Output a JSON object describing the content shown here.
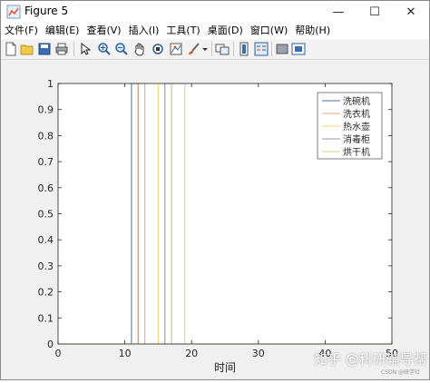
{
  "window": {
    "title": "Figure 5",
    "minimize_glyph": "—",
    "maximize_glyph": "☐",
    "close_glyph": "✕"
  },
  "menu": {
    "items": [
      "文件(F)",
      "编辑(E)",
      "查看(V)",
      "插入(I)",
      "工具(T)",
      "桌面(D)",
      "窗口(W)",
      "帮助(H)"
    ]
  },
  "toolbar": {
    "icons": [
      "new-figure-icon",
      "open-file-icon",
      "save-icon",
      "print-icon",
      "edit-plot-arrow-icon",
      "zoom-in-icon",
      "zoom-out-icon",
      "pan-hand-icon",
      "rotate-3d-icon",
      "data-cursor-icon",
      "brush-icon",
      "brush-dropdown-icon",
      "link-plot-icon",
      "insert-colorbar-icon",
      "insert-legend-icon",
      "hide-plot-tools-icon",
      "show-plot-tools-icon"
    ]
  },
  "chart_data": {
    "type": "line",
    "title": "",
    "xlabel": "时间",
    "ylabel": "",
    "xlim": [
      0,
      50
    ],
    "ylim": [
      0,
      1
    ],
    "xticks": [
      0,
      10,
      20,
      30,
      40,
      50
    ],
    "yticks": [
      0,
      0.1,
      0.2,
      0.3,
      0.4,
      0.5,
      0.6,
      0.7,
      0.8,
      0.9,
      1
    ],
    "grid": false,
    "legend_position": "top-right",
    "series": [
      {
        "name": "洗碗机",
        "color": "#4a6f9c",
        "x": [
          0,
          11,
          11,
          12,
          12,
          50
        ],
        "y": [
          0,
          0,
          1,
          1,
          0,
          0
        ]
      },
      {
        "name": "洗衣机",
        "color": "#e3a27a",
        "x": [
          0,
          12,
          12,
          13,
          13,
          50
        ],
        "y": [
          0,
          0,
          1,
          1,
          0,
          0
        ]
      },
      {
        "name": "热水壶",
        "color": "#f2d27a",
        "x": [
          0,
          15,
          15,
          16,
          16,
          50
        ],
        "y": [
          0,
          0,
          1,
          1,
          0,
          0
        ]
      },
      {
        "name": "消毒柜",
        "color": "#9a8fc0",
        "x": [
          0,
          16,
          16,
          17,
          17,
          50
        ],
        "y": [
          0,
          0,
          1,
          1,
          0,
          0
        ]
      },
      {
        "name": "烘干机",
        "color": "#c9d98a",
        "x": [
          0,
          17,
          17,
          19,
          19,
          50
        ],
        "y": [
          0,
          0,
          1,
          1,
          0,
          0
        ]
      }
    ]
  },
  "watermark": {
    "main": "知乎 @科研辅导帮",
    "small": "CSDN @研学社"
  }
}
